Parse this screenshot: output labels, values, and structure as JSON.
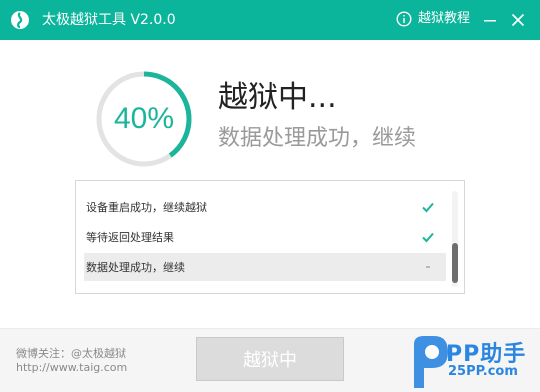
{
  "titlebar": {
    "title": "太极越狱工具 V2.0.0",
    "tutorial_label": "越狱教程",
    "bg_color": "#0bb59b"
  },
  "progress": {
    "percent": 40,
    "label": "40%",
    "color": "#1bb59b",
    "track_color": "#e3e3e3"
  },
  "status": {
    "title": "越狱中...",
    "subtitle": "数据处理成功，继续"
  },
  "log": {
    "items": [
      {
        "text": "设备重启成功，继续越狱",
        "state": "done"
      },
      {
        "text": "等待返回处理结果",
        "state": "done"
      },
      {
        "text": "数据处理成功，继续",
        "state": "pending"
      }
    ]
  },
  "footer": {
    "weibo": "微博关注：@太极越狱",
    "site": "http://www.taig.com",
    "button_label": "越狱中"
  },
  "watermark": {
    "main": "PP助手",
    "sub": "25PP.com"
  },
  "icons": {
    "logo": "taichi-logo-icon",
    "info": "info-icon",
    "minimize": "minimize-icon",
    "close": "close-icon",
    "check": "check-icon"
  }
}
